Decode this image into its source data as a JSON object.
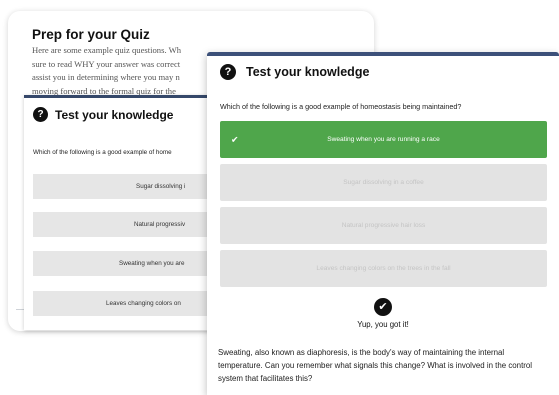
{
  "back": {
    "title": "Prep for your Quiz",
    "intro_lines": [
      "Here are some example quiz questions. Wh",
      "sure to read WHY your answer was correct",
      "assist you in determining where you may n",
      "moving forward to the formal quiz for the"
    ],
    "quiz": {
      "heading": "Test your knowledge",
      "question": "Which of the following is a good example of home",
      "options": [
        "Sugar dissolving i",
        "Natural progressiv",
        "Sweating when you are",
        "Leaves changing colors on"
      ]
    }
  },
  "front": {
    "heading": "Test your knowledge",
    "question": "Which of the following is a good example of homeostasis being maintained?",
    "options": [
      {
        "label": "Sweating when you are running a race",
        "state": "correct"
      },
      {
        "label": "Sugar dissolving in a coffee",
        "state": "disabled"
      },
      {
        "label": "Natural progressive hair loss",
        "state": "disabled"
      },
      {
        "label": "Leaves changing colors on the trees in the fall",
        "state": "disabled"
      }
    ],
    "result": "Yup, you got it!",
    "explanation": "Sweating, also known as diaphoresis, is the body's way of maintaining the internal temperature. Can you remember what signals this change? What is involved in the control system that facilitates this?"
  },
  "icons": {
    "question": "question-circle-icon",
    "check": "check-icon",
    "check_circle": "check-circle-icon"
  },
  "colors": {
    "correct": "#4fa64b",
    "header_bar": "#3c5079",
    "option_bg": "#e3e3e3"
  }
}
